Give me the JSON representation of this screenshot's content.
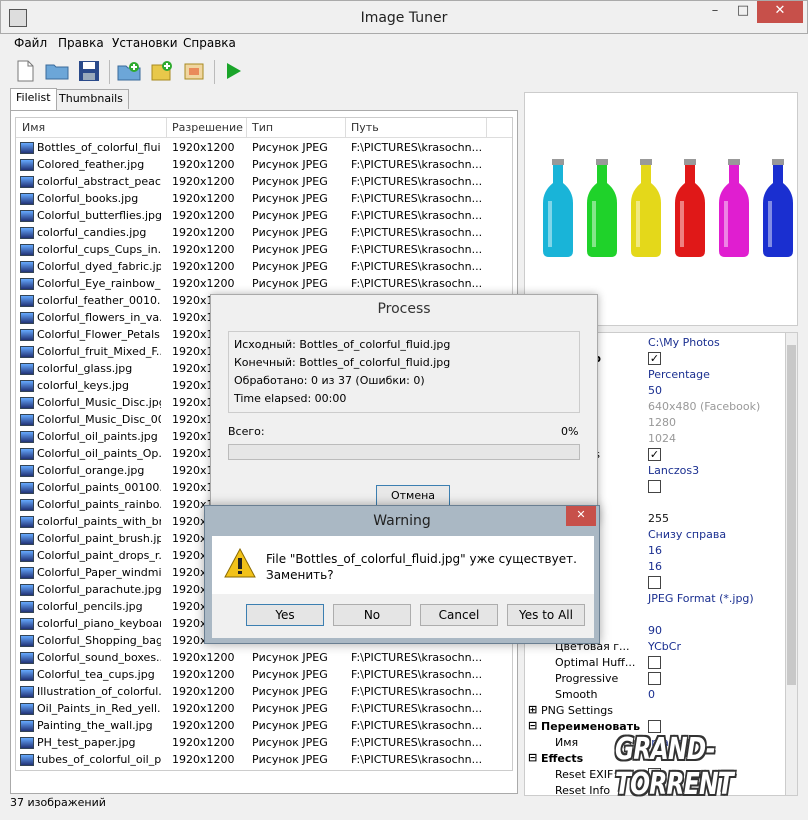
{
  "window": {
    "title": "Image Tuner"
  },
  "menu": [
    "Файл",
    "Правка",
    "Установки",
    "Справка"
  ],
  "toolbar_icons": [
    "new-file-icon",
    "open-folder-icon",
    "save-icon",
    "add-folder-icon",
    "add-image-icon",
    "remove-image-icon",
    "play-icon"
  ],
  "tabs": [
    "Filelist",
    "Thumbnails"
  ],
  "columns": [
    "Имя",
    "Разрешение",
    "Тип",
    "Путь"
  ],
  "files": [
    [
      "Bottles_of_colorful_flui...",
      "1920x1200",
      "Рисунок JPEG",
      "F:\\PICTURES\\krasochn..."
    ],
    [
      "Colored_feather.jpg",
      "1920x1200",
      "Рисунок JPEG",
      "F:\\PICTURES\\krasochn..."
    ],
    [
      "colorful_abstract_peac...",
      "1920x1200",
      "Рисунок JPEG",
      "F:\\PICTURES\\krasochn..."
    ],
    [
      "Colorful_books.jpg",
      "1920x1200",
      "Рисунок JPEG",
      "F:\\PICTURES\\krasochn..."
    ],
    [
      "Colorful_butterflies.jpg",
      "1920x1200",
      "Рисунок JPEG",
      "F:\\PICTURES\\krasochn..."
    ],
    [
      "colorful_candies.jpg",
      "1920x1200",
      "Рисунок JPEG",
      "F:\\PICTURES\\krasochn..."
    ],
    [
      "colorful_cups_Cups_in...",
      "1920x1200",
      "Рисунок JPEG",
      "F:\\PICTURES\\krasochn..."
    ],
    [
      "Colorful_dyed_fabric.jpg",
      "1920x1200",
      "Рисунок JPEG",
      "F:\\PICTURES\\krasochn..."
    ],
    [
      "Colorful_Eye_rainbow_...",
      "1920x1200",
      "Рисунок JPEG",
      "F:\\PICTURES\\krasochn..."
    ],
    [
      "colorful_feather_0010...",
      "1920x12",
      "",
      " "
    ],
    [
      "Colorful_flowers_in_va...",
      "1920x12",
      "",
      ""
    ],
    [
      "Colorful_Flower_Petals...",
      "1920x12",
      "",
      ""
    ],
    [
      "Colorful_fruit_Mixed_F...",
      "1920x12",
      "",
      ""
    ],
    [
      "colorful_glass.jpg",
      "1920x12",
      "",
      ""
    ],
    [
      "colorful_keys.jpg",
      "1920x12",
      "",
      ""
    ],
    [
      "Colorful_Music_Disc.jpg",
      "1920x12",
      "",
      ""
    ],
    [
      "Colorful_Music_Disc_00...",
      "1920x12",
      "",
      ""
    ],
    [
      "Colorful_oil_paints.jpg",
      "1920x12",
      "",
      ""
    ],
    [
      "Colorful_oil_paints_Op...",
      "1920x12",
      "",
      ""
    ],
    [
      "Colorful_orange.jpg",
      "1920x12",
      "",
      ""
    ],
    [
      "Colorful_paints_00100...",
      "1920x12",
      "",
      ""
    ],
    [
      "Colorful_paints_rainbo...",
      "1920x12",
      "",
      ""
    ],
    [
      "colorful_paints_with_br...",
      "1920x12",
      "",
      ""
    ],
    [
      "Colorful_paint_brush.jpg",
      "1920x12",
      "",
      ""
    ],
    [
      "Colorful_paint_drops_r...",
      "1920x12",
      "",
      ""
    ],
    [
      "Colorful_Paper_windmil...",
      "1920x12",
      "",
      ""
    ],
    [
      "Colorful_parachute.jpg",
      "1920x12",
      "",
      ""
    ],
    [
      "colorful_pencils.jpg",
      "1920x12",
      "",
      ""
    ],
    [
      "colorful_piano_keyboar...",
      "1920x12",
      "",
      ""
    ],
    [
      "Colorful_Shopping_bag...",
      "1920x12",
      "",
      ""
    ],
    [
      "Colorful_sound_boxes....",
      "1920x1200",
      "Рисунок JPEG",
      "F:\\PICTURES\\krasochn..."
    ],
    [
      "Colorful_tea_cups.jpg",
      "1920x1200",
      "Рисунок JPEG",
      "F:\\PICTURES\\krasochn..."
    ],
    [
      "Illustration_of_colorful...",
      "1920x1200",
      "Рисунок JPEG",
      "F:\\PICTURES\\krasochn..."
    ],
    [
      "Oil_Paints_in_Red_yell...",
      "1920x1200",
      "Рисунок JPEG",
      "F:\\PICTURES\\krasochn..."
    ],
    [
      "Painting_the_wall.jpg",
      "1920x1200",
      "Рисунок JPEG",
      "F:\\PICTURES\\krasochn..."
    ],
    [
      "PH_test_paper.jpg",
      "1920x1200",
      "Рисунок JPEG",
      "F:\\PICTURES\\krasochn..."
    ],
    [
      "tubes_of_colorful_oil_p...",
      "1920x1200",
      "Рисунок JPEG",
      "F:\\PICTURES\\krasochn..."
    ]
  ],
  "preview_bottle_colors": [
    "#19b4d8",
    "#1fd22a",
    "#e4d81a",
    "#e01818",
    "#e01ed0",
    "#1a2fd0"
  ],
  "properties": [
    {
      "label": "в",
      "value": "C:\\My Photos",
      "kind": "text"
    },
    {
      "label": "размер",
      "check": true,
      "kind": "check",
      "bold": true
    },
    {
      "label": "y",
      "value": "Percentage",
      "kind": "text"
    },
    {
      "label": "age (%)",
      "value": "50",
      "kind": "text"
    },
    {
      "label": "ze",
      "value": "640x480 (Facebook)",
      "kind": "dim"
    },
    {
      "label": "Width",
      "value": "1280",
      "kind": "dim"
    },
    {
      "label": "Height",
      "value": "1024",
      "kind": "dim"
    },
    {
      "label": "portions",
      "check": true,
      "kind": "check"
    },
    {
      "label": "",
      "value": "Lanczos3",
      "kind": "text"
    },
    {
      "label": "знак",
      "check": false,
      "kind": "check",
      "bold": true
    },
    {
      "label": "ath",
      "value": "",
      "kind": "text"
    },
    {
      "label": "ость",
      "value": "255",
      "kind": "light"
    },
    {
      "label": "",
      "value": "Снизу справа",
      "kind": "text"
    },
    {
      "label": "",
      "value": "16",
      "kind": "text"
    },
    {
      "label": "",
      "value": "16",
      "kind": "text"
    },
    {
      "label": "овать",
      "check": false,
      "kind": "check",
      "bold": true
    },
    {
      "label": "",
      "value": "JPEG Format (*.jpg)",
      "kind": "text"
    },
    {
      "label": "новки",
      "value": "",
      "kind": "text"
    },
    {
      "label": "во",
      "value": "90",
      "kind": "text"
    },
    {
      "label": "Цветовая г...",
      "value": "YCbCr",
      "kind": "text"
    },
    {
      "label": "Optimal Huff...",
      "check": false,
      "kind": "check"
    },
    {
      "label": "Progressive",
      "check": false,
      "kind": "check"
    },
    {
      "label": "Smooth",
      "value": "0",
      "kind": "text"
    },
    {
      "label": "PNG Settings",
      "value": "",
      "kind": "expand",
      "exp": "⊞"
    },
    {
      "label": "Переименовать",
      "check": false,
      "kind": "check",
      "bold": true,
      "exp": "⊟"
    },
    {
      "label": "Имя",
      "value": "Image_",
      "kind": "text"
    },
    {
      "label": "Effects",
      "value": "",
      "kind": "section",
      "bold": true,
      "exp": "⊟"
    },
    {
      "label": "Reset EXIF",
      "check": false,
      "kind": "check"
    },
    {
      "label": "Reset Info",
      "check": false,
      "kind": "check"
    }
  ],
  "status": "37 изображений",
  "process": {
    "title": "Process",
    "source": "Исходный: Bottles_of_colorful_fluid.jpg",
    "target": "Конечный: Bottles_of_colorful_fluid.jpg",
    "processed": "Обработано: 0 из 37 (Ошибки: 0)",
    "elapsed": "Time elapsed: 00:00",
    "total_label": "Всего:",
    "percent": "0%",
    "progress": 0,
    "cancel": "Отмена"
  },
  "warning": {
    "title": "Warning",
    "line1": "File \"Bottles_of_colorful_fluid.jpg\" уже существует.",
    "line2": "Заменить?",
    "buttons": [
      "Yes",
      "No",
      "Cancel",
      "Yes to All"
    ]
  },
  "watermark": "GRAND-TORRENT"
}
